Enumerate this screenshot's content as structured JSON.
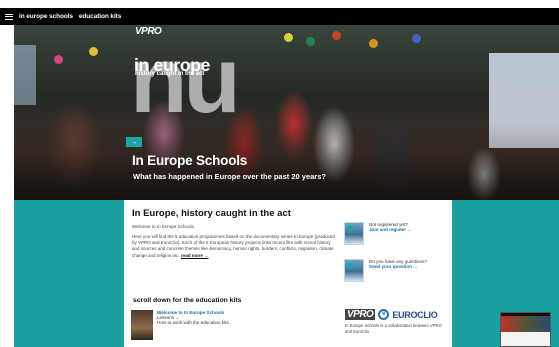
{
  "nav": {
    "menu_icon": "hamburger-icon",
    "link_site": "in europe schools",
    "link_kits": "education kits"
  },
  "hero": {
    "vpro_logo": "VPRO",
    "nu_letters": "nu",
    "brand_title": "in europe",
    "brand_subtitle": "history caught in the act",
    "arrow": "→",
    "title": "In Europe Schools",
    "subtitle": "What has happened in Europe over the past 20 years?"
  },
  "main": {
    "heading": "In Europe, history caught in the act",
    "welcome": "Welcome to In Europe Schools.",
    "intro": "Here you will find the 5 education programmes based on the documentary series In Europe (produced by VPRO and EuroClio). Each of the 5 European history projects links recent film with recent history and sources and concrete themes like democracy, human rights, borders, conflicts, migration, climate change and religion etc.",
    "read_more": "read more →"
  },
  "side_links": [
    {
      "line1": "Not registered yet?",
      "line2": "Join and register →"
    },
    {
      "line1": "Do you have any questions?",
      "line2": "Send your question →"
    }
  ],
  "kits": {
    "title": "scroll down for the education kits",
    "items": [
      {
        "title": "Welcome to In Europe Schools",
        "subtitle": "Lessons →",
        "desc": "How to work with the education kits"
      }
    ]
  },
  "partners": {
    "vpro": "VPRO",
    "euroclio": "EUROCLIO",
    "text": "In Europe Schools is a collaboration between VPRO and EuroClio"
  },
  "colors": {
    "accent": "#1aa7a5",
    "band": "#1aa0a0",
    "nav": "#000000"
  }
}
